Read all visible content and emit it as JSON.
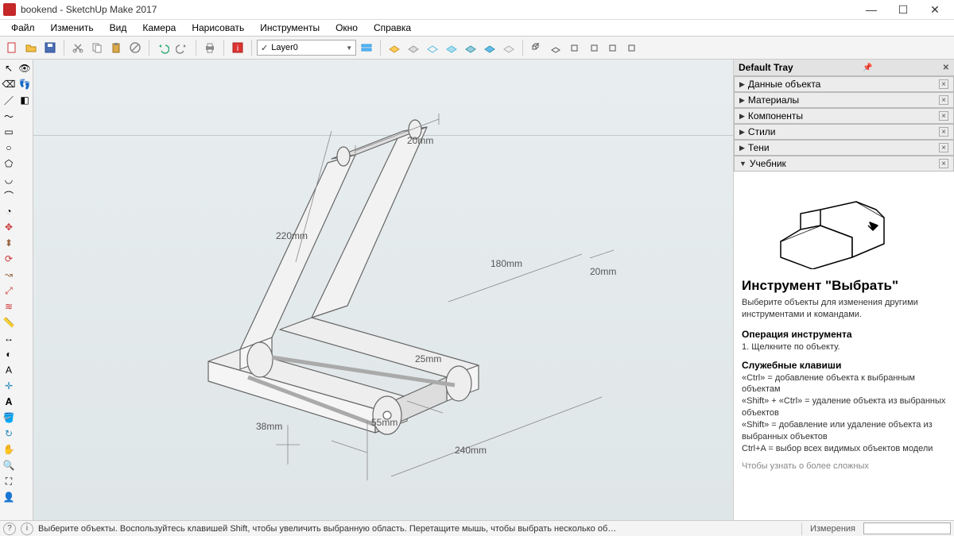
{
  "window": {
    "title": "bookend - SketchUp Make 2017",
    "minimize": "—",
    "maximize": "☐",
    "close": "✕"
  },
  "menu": [
    "Файл",
    "Изменить",
    "Вид",
    "Камера",
    "Нарисовать",
    "Инструменты",
    "Окно",
    "Справка"
  ],
  "layer": {
    "check": "✓",
    "name": "Layer0"
  },
  "dimensions": {
    "d20a": "20mm",
    "d220": "220mm",
    "d180": "180mm",
    "d20b": "20mm",
    "d25": "25mm",
    "d55": "55mm",
    "d38": "38mm",
    "d240": "240mm"
  },
  "tray": {
    "title": "Default Tray",
    "panels": [
      "Данные объекта",
      "Материалы",
      "Компоненты",
      "Стили",
      "Тени",
      "Учебник"
    ]
  },
  "instructor": {
    "title": "Инструмент \"Выбрать\"",
    "lead": "Выберите объекты для изменения другими инструментами и командами.",
    "op_head": "Операция инструмента",
    "op1": "1. Щелкните по объекту.",
    "keys_head": "Служебные клавиши",
    "k1": "«Ctrl» = добавление объекта к выбранным объектам",
    "k2": "«Shift» + «Ctrl» = удаление объекта из выбранных объектов",
    "k3": "«Shift» = добавление или удаление объекта из выбранных объектов",
    "k4": "Ctrl+A = выбор всех видимых объектов модели",
    "more": "Чтобы узнать о более сложных"
  },
  "status": {
    "text": "Выберите объекты. Воспользуйтесь клавишей Shift, чтобы увеличить выбранную область. Перетащите мышь, чтобы выбрать несколько об…",
    "measure": "Измерения"
  }
}
